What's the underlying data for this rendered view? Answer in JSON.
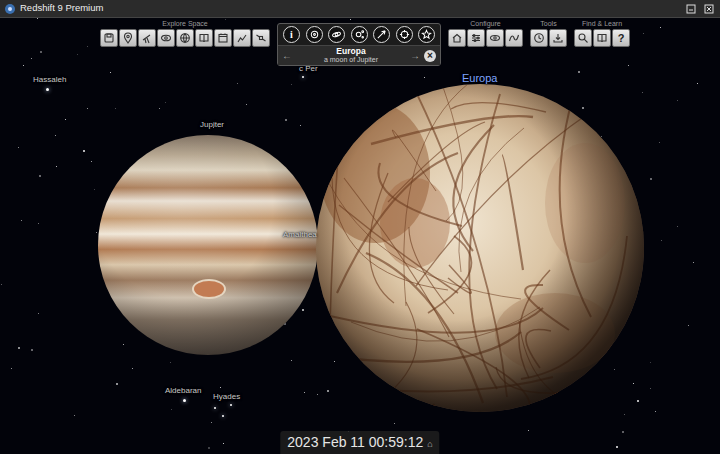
{
  "window": {
    "title": "Redshift 9 Premium"
  },
  "toolbar": {
    "groups": [
      {
        "label": "Explore Space",
        "buttons": [
          {
            "kind": "save"
          },
          {
            "kind": "location"
          },
          {
            "kind": "telescope"
          },
          {
            "kind": "view"
          },
          {
            "kind": "guide"
          },
          {
            "kind": "book"
          },
          {
            "kind": "calendar"
          },
          {
            "kind": "chart"
          },
          {
            "kind": "satellite"
          }
        ]
      },
      {
        "label": "Configure",
        "buttons": [
          {
            "kind": "home"
          },
          {
            "kind": "settings"
          },
          {
            "kind": "orbitpath"
          },
          {
            "kind": "graph"
          }
        ]
      },
      {
        "label": "Tools",
        "buttons": [
          {
            "kind": "clock"
          },
          {
            "kind": "export"
          }
        ]
      },
      {
        "label": "Find & Learn",
        "buttons": [
          {
            "kind": "search"
          },
          {
            "kind": "book"
          },
          {
            "kind": "help",
            "glyph": "?"
          }
        ]
      }
    ]
  },
  "info_panel": {
    "buttons": [
      {
        "kind": "info",
        "glyph": "i"
      },
      {
        "kind": "center"
      },
      {
        "kind": "orbit"
      },
      {
        "kind": "moons"
      },
      {
        "kind": "fly"
      },
      {
        "kind": "track"
      },
      {
        "kind": "favorite"
      }
    ],
    "title": "Europa",
    "subtitle": "a moon of Jupiter",
    "prev": "←",
    "next": "→",
    "close": "×"
  },
  "sky_labels": [
    {
      "text": "Hassaleh",
      "selected": false
    },
    {
      "text": "c Per",
      "selected": false
    },
    {
      "text": "Jupiter",
      "selected": false
    },
    {
      "text": "Europa",
      "selected": true
    },
    {
      "text": "Amalthea",
      "selected": false
    },
    {
      "text": "Aldebaran",
      "selected": false
    },
    {
      "text": "Hyades",
      "selected": false
    }
  ],
  "time_bar": {
    "datetime": "2023 Feb 11 00:59:12",
    "home": "⌂"
  }
}
